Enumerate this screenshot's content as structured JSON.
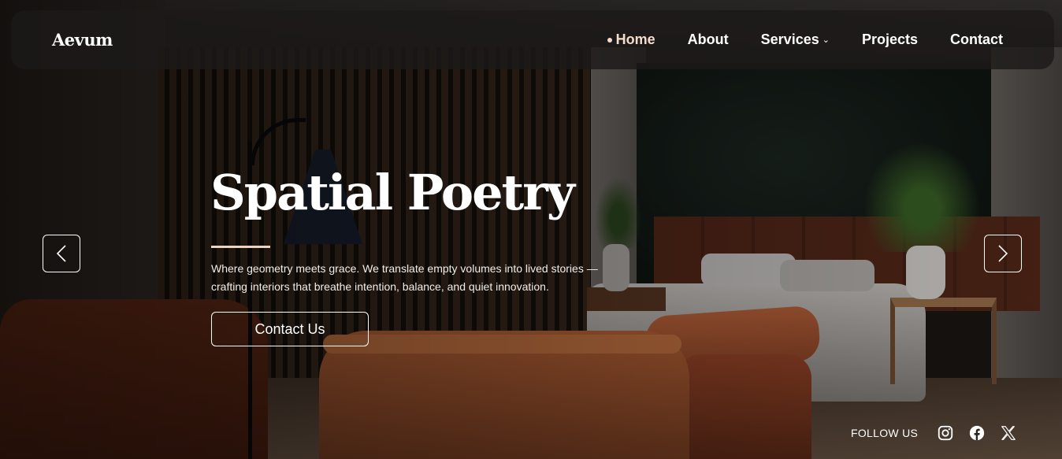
{
  "brand": {
    "name": "Aevum"
  },
  "nav": {
    "items": [
      {
        "label": "Home",
        "active": true
      },
      {
        "label": "About"
      },
      {
        "label": "Services",
        "has_dropdown": true
      },
      {
        "label": "Projects"
      },
      {
        "label": "Contact"
      }
    ],
    "dropdown_glyph": "⌄"
  },
  "hero": {
    "title": "Spatial Poetry",
    "description": "Where geometry meets grace. We translate empty volumes into lived stories — crafting interiors that breathe intention, balance, and quiet innovation.",
    "cta_label": "Contact Us"
  },
  "carousel": {
    "prev_icon": "chevron-left-icon",
    "next_icon": "chevron-right-icon"
  },
  "follow": {
    "label": "FOLLOW US",
    "icons": [
      "instagram-icon",
      "facebook-icon",
      "x-icon"
    ]
  },
  "colors": {
    "accent": "#f4dccb",
    "navbar_bg": "#1c1a19"
  }
}
